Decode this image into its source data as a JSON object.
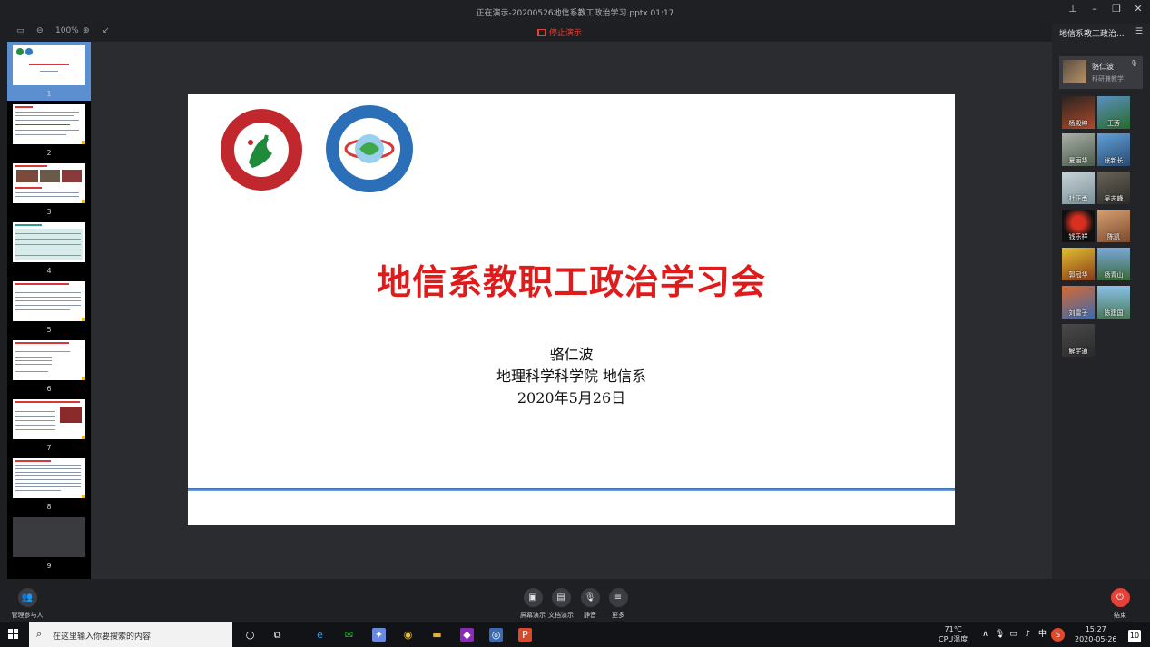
{
  "window": {
    "title": "正在演示-20200526地信系教工政治学习.pptx 01:17"
  },
  "toolbar": {
    "zoom": "100%",
    "stop_label": "停止演示"
  },
  "thumbnails": [
    {
      "number": "1"
    },
    {
      "number": "2"
    },
    {
      "number": "3"
    },
    {
      "number": "4"
    },
    {
      "number": "5"
    },
    {
      "number": "6"
    },
    {
      "number": "7"
    },
    {
      "number": "8"
    },
    {
      "number": "9"
    }
  ],
  "slide": {
    "title": "地信系教职工政治学习会",
    "presenter": "骆仁波",
    "affiliation": "地理科学科学院 地信系",
    "date": "2020年5月26日",
    "title_color": "#e01b1b"
  },
  "sidebar": {
    "room_name": "地信系教工政治...",
    "host": {
      "name": "骆仁波",
      "subtitle": "科研兼教学"
    },
    "participants": [
      "杨殿坤",
      "王芳",
      "夏丽华",
      "张新长",
      "杜正勇",
      "吴志峰",
      "钱乐祥",
      "陈凯",
      "郭冠华",
      "杨青山",
      "刘雷子",
      "陈建国",
      "解宇通"
    ]
  },
  "controls": {
    "manage": "管理参与人",
    "screen_share": "屏幕演示",
    "doc_share": "文档演示",
    "mute": "静音",
    "more": "更多",
    "end": "结束"
  },
  "taskbar": {
    "search_placeholder": "在这里输入你要搜索的内容",
    "cpu_temp": "71℃",
    "cpu_label": "CPU温度",
    "ime": "中",
    "time": "15:27",
    "date": "2020-05-26",
    "notification_count": "10"
  }
}
